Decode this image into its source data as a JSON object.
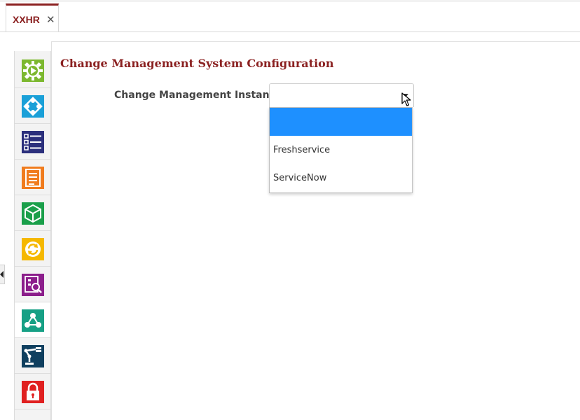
{
  "tabs": [
    {
      "label": "XXHR",
      "close": "✕"
    }
  ],
  "rail": {
    "items": [
      {
        "icon": "play-gear-icon",
        "color": "#7cb82f",
        "active": false
      },
      {
        "icon": "integration-icon",
        "color": "#1aa0d8",
        "active": false
      },
      {
        "icon": "checklist-icon",
        "color": "#2b2f7c",
        "active": false
      },
      {
        "icon": "document-icon",
        "color": "#f07c1e",
        "active": false
      },
      {
        "icon": "package-icon",
        "color": "#1a9f4a",
        "active": false
      },
      {
        "icon": "refresh-icon",
        "color": "#f5b800",
        "active": false
      },
      {
        "icon": "search-report-icon",
        "color": "#8b1e8b",
        "active": false
      },
      {
        "icon": "network-icon",
        "color": "#16a085",
        "active": true
      },
      {
        "icon": "robot-arm-icon",
        "color": "#0f3f5f",
        "active": false
      },
      {
        "icon": "lock-icon",
        "color": "#e02020",
        "active": false
      }
    ]
  },
  "page": {
    "title": "Change Management System Configuration"
  },
  "form": {
    "instance_label": "Change Management Instance",
    "instance_value": "",
    "options": [
      "",
      "Freshservice",
      "ServiceNow"
    ],
    "highlighted_index": 0
  },
  "colors": {
    "accent": "#8b2121",
    "highlight": "#1e90ff"
  }
}
